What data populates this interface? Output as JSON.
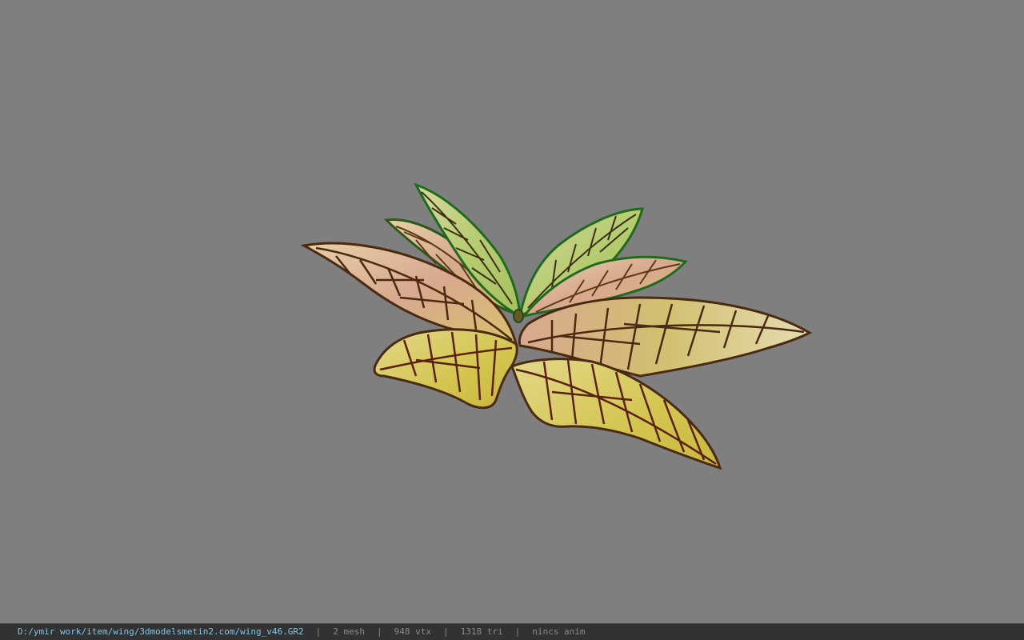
{
  "viewer": {
    "background_color": "#7f7f7f",
    "model_name": "wing_v46.GR2"
  },
  "status_bar": {
    "file_path": "D:/ymir work/item/wing/3dmodelsmetin2.com/wing_v46.GR2",
    "separator": "|",
    "mesh_count": "2 mesh",
    "vertex_count": "948 vtx",
    "triangle_count": "1318 tri",
    "animation": "nincs anim",
    "path_color": "#7fc8e8",
    "text_color": "#8a8a8a"
  },
  "wing_colors": {
    "membrane_yellow": "#d8d060",
    "membrane_pink": "#d9a890",
    "membrane_green": "#b6cc70",
    "vein_dark": "#4a2a10",
    "edge_green": "#1f6a1f"
  }
}
